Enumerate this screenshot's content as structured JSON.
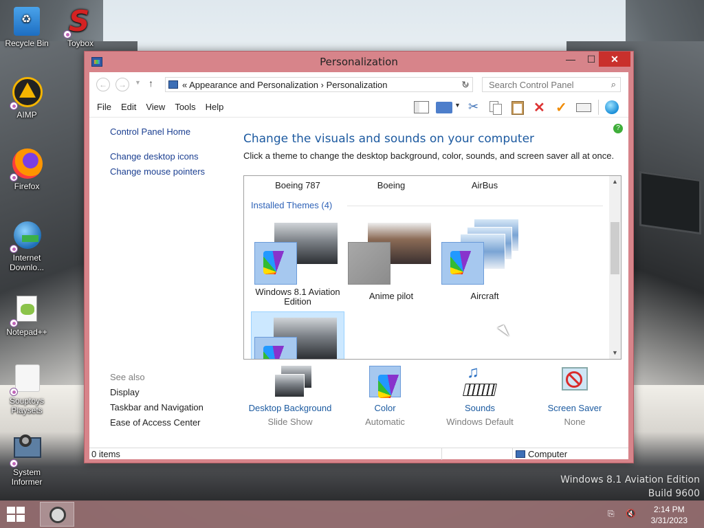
{
  "desktop": {
    "icons": [
      {
        "label": "Recycle Bin"
      },
      {
        "label": "Toybox"
      },
      {
        "label": "AIMP"
      },
      {
        "label": "Firefox"
      },
      {
        "label": "Internet Downlo..."
      },
      {
        "label": "Notepad++"
      },
      {
        "label": "Souptoys Playsets"
      },
      {
        "label": "System Informer"
      }
    ],
    "watermark": {
      "line1": "Windows 8.1 Aviation Edition",
      "line2": "Build 9600"
    }
  },
  "window": {
    "title": "Personalization",
    "controls": {
      "minimize": "—",
      "maximize": "☐",
      "close": "✕"
    }
  },
  "address": {
    "crumbs": "«  Appearance and Personalization  ›  Personalization",
    "search_placeholder": "Search Control Panel"
  },
  "menu": [
    "File",
    "Edit",
    "View",
    "Tools",
    "Help"
  ],
  "toolbar": [
    "layout-icon",
    "folder-icon",
    "cut-icon",
    "copy-icon",
    "paste-icon",
    "delete-icon",
    "check-icon",
    "properties-icon",
    "globe-icon"
  ],
  "left_pane": {
    "home": "Control Panel Home",
    "links": [
      "Change desktop icons",
      "Change mouse pointers"
    ],
    "see_also_label": "See also",
    "see_also": [
      "Display",
      "Taskbar and Navigation",
      "Ease of Access Center"
    ]
  },
  "main": {
    "heading": "Change the visuals and sounds on your computer",
    "description": "Click a theme to change the desktop background, color, sounds, and screen saver all at once.",
    "top_themes": [
      "Boeing 787",
      "Boeing",
      "AirBus"
    ],
    "installed_title": "Installed Themes (4)",
    "installed": [
      {
        "name": "Windows 8.1 Aviation Edition"
      },
      {
        "name": "Anime pilot"
      },
      {
        "name": "Aircraft"
      }
    ]
  },
  "bottom": [
    {
      "name": "Desktop Background",
      "value": "Slide Show"
    },
    {
      "name": "Color",
      "value": "Automatic"
    },
    {
      "name": "Sounds",
      "value": "Windows Default"
    },
    {
      "name": "Screen Saver",
      "value": "None"
    }
  ],
  "status": {
    "items": "0 items",
    "location": "Computer"
  },
  "taskbar": {
    "time": "2:14 PM",
    "date": "3/31/2023"
  }
}
